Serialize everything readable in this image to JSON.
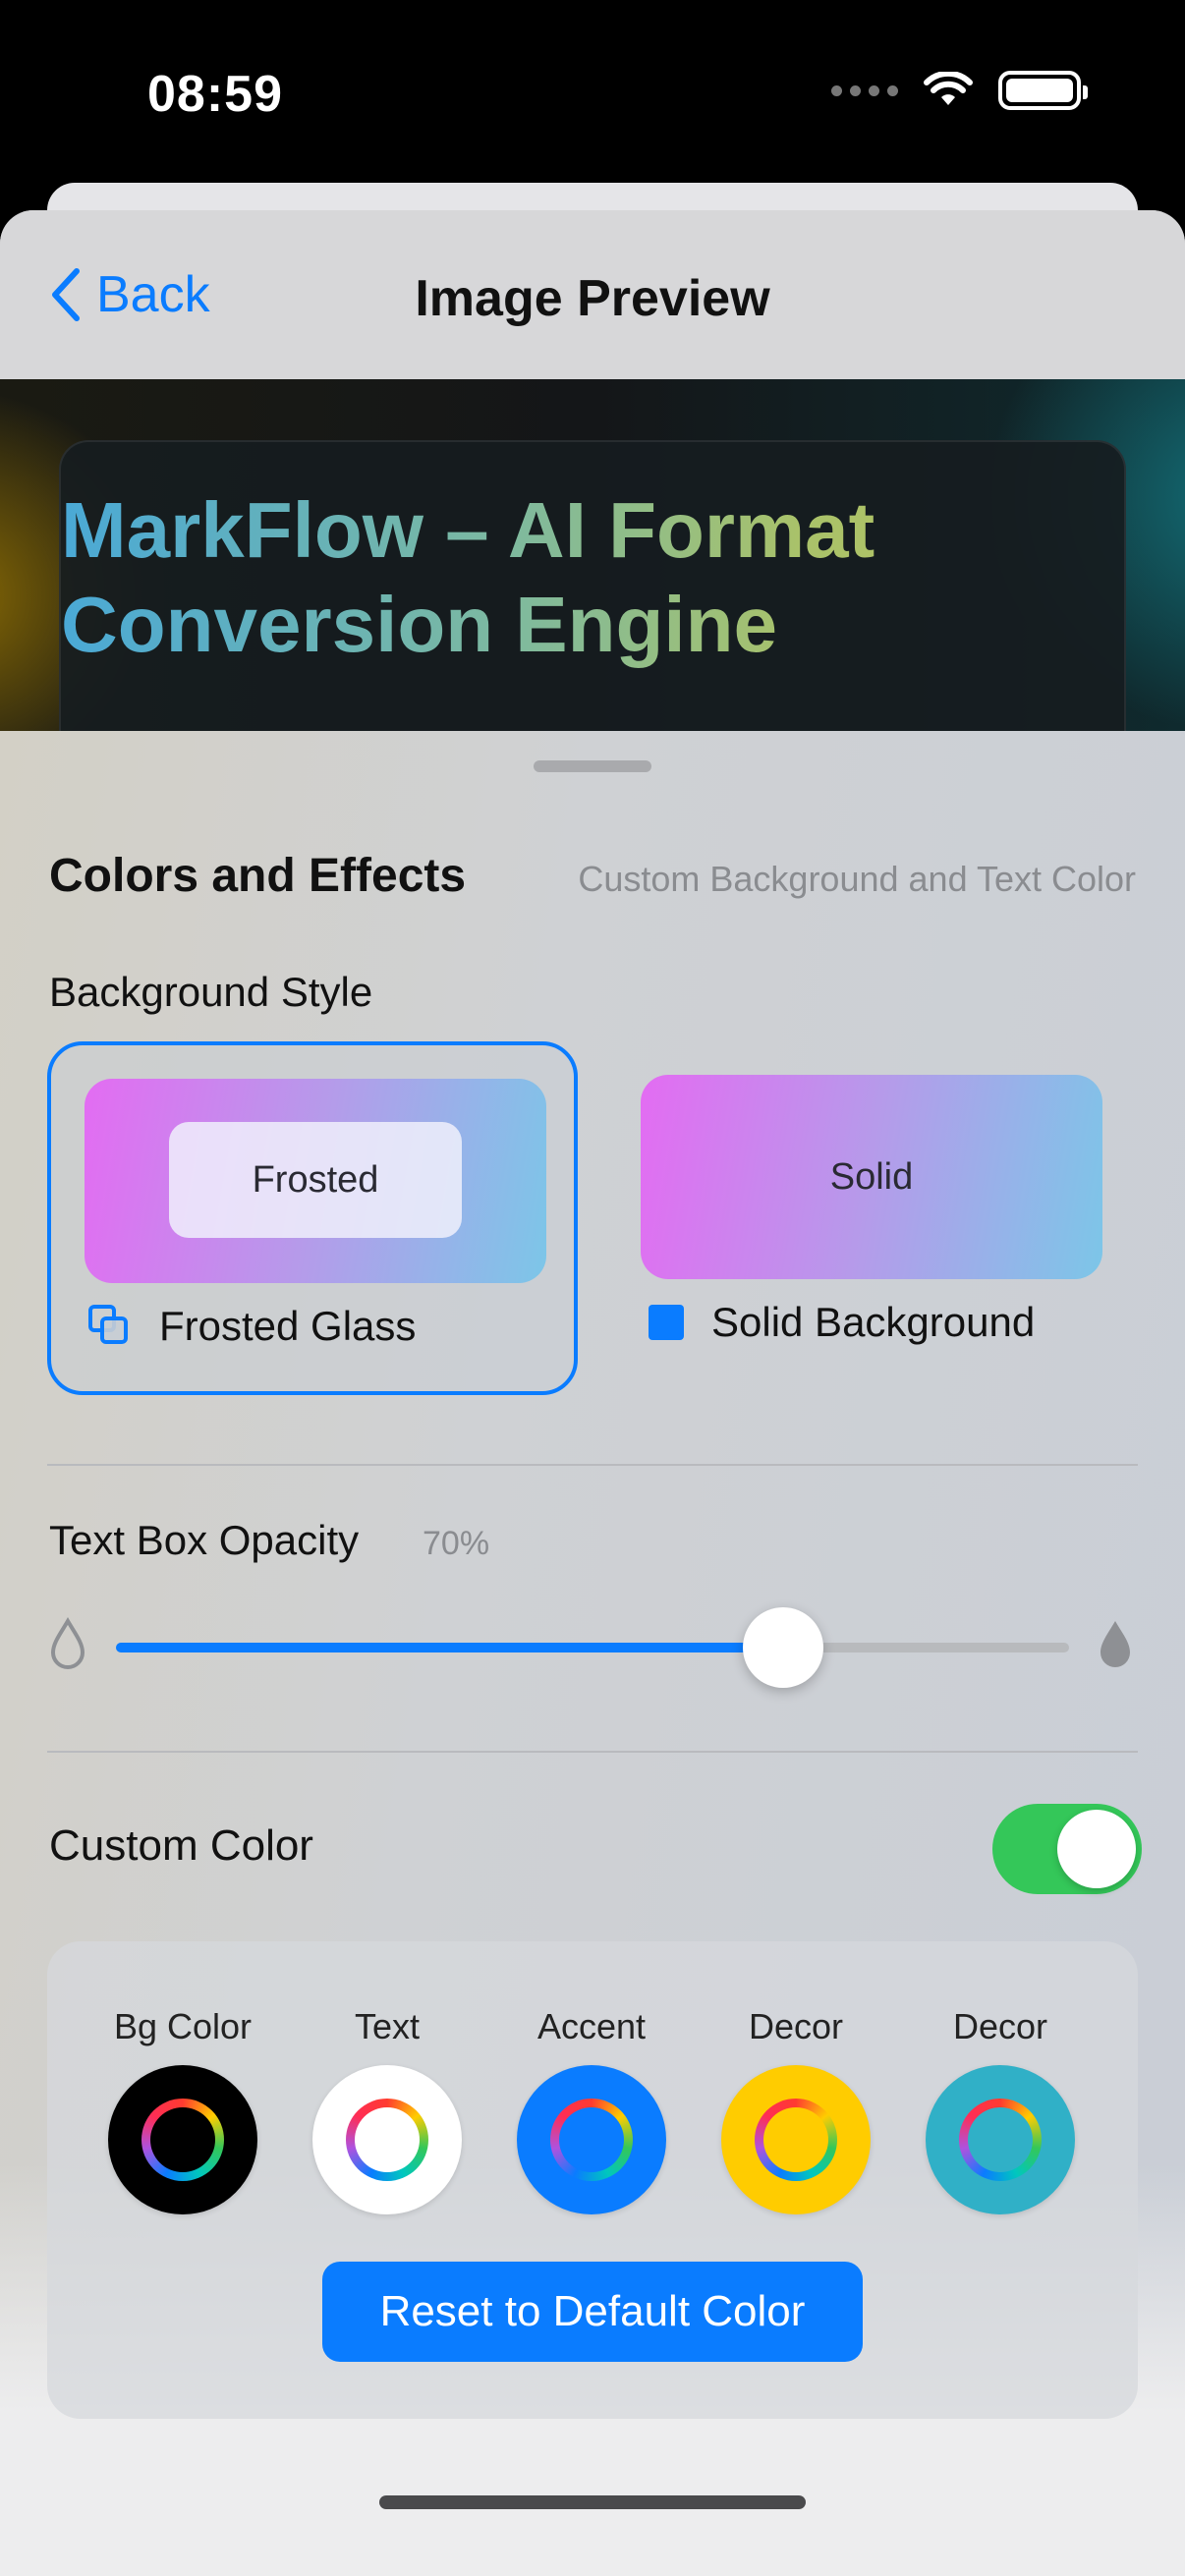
{
  "status_bar": {
    "time": "08:59"
  },
  "nav": {
    "back_label": "Back",
    "title": "Image Preview"
  },
  "preview": {
    "title": "MarkFlow – AI Format Conversion Engine"
  },
  "colors_effects": {
    "title": "Colors and Effects",
    "subtitle": "Custom Background and Text Color",
    "background_style_label": "Background Style",
    "options": [
      {
        "chip_text": "Frosted",
        "label": "Frosted Glass",
        "selected": true,
        "icon": "frosted-glass-icon"
      },
      {
        "chip_text": "Solid",
        "label": "Solid Background",
        "selected": false,
        "icon": "solid-square-icon"
      }
    ]
  },
  "opacity": {
    "label": "Text Box Opacity",
    "value_text": "70%",
    "value": 0.7
  },
  "custom_color": {
    "label": "Custom Color",
    "enabled": true,
    "swatches": [
      {
        "label": "Bg Color",
        "color": "#000000"
      },
      {
        "label": "Text",
        "color": "#ffffff"
      },
      {
        "label": "Accent",
        "color": "#0a7cff"
      },
      {
        "label": "Decor",
        "color": "#ffcc00"
      },
      {
        "label": "Decor",
        "color": "#30b0c7"
      }
    ],
    "reset_label": "Reset to Default Color"
  },
  "accent_color": "#0a7cff",
  "toggle_color": "#34c759"
}
